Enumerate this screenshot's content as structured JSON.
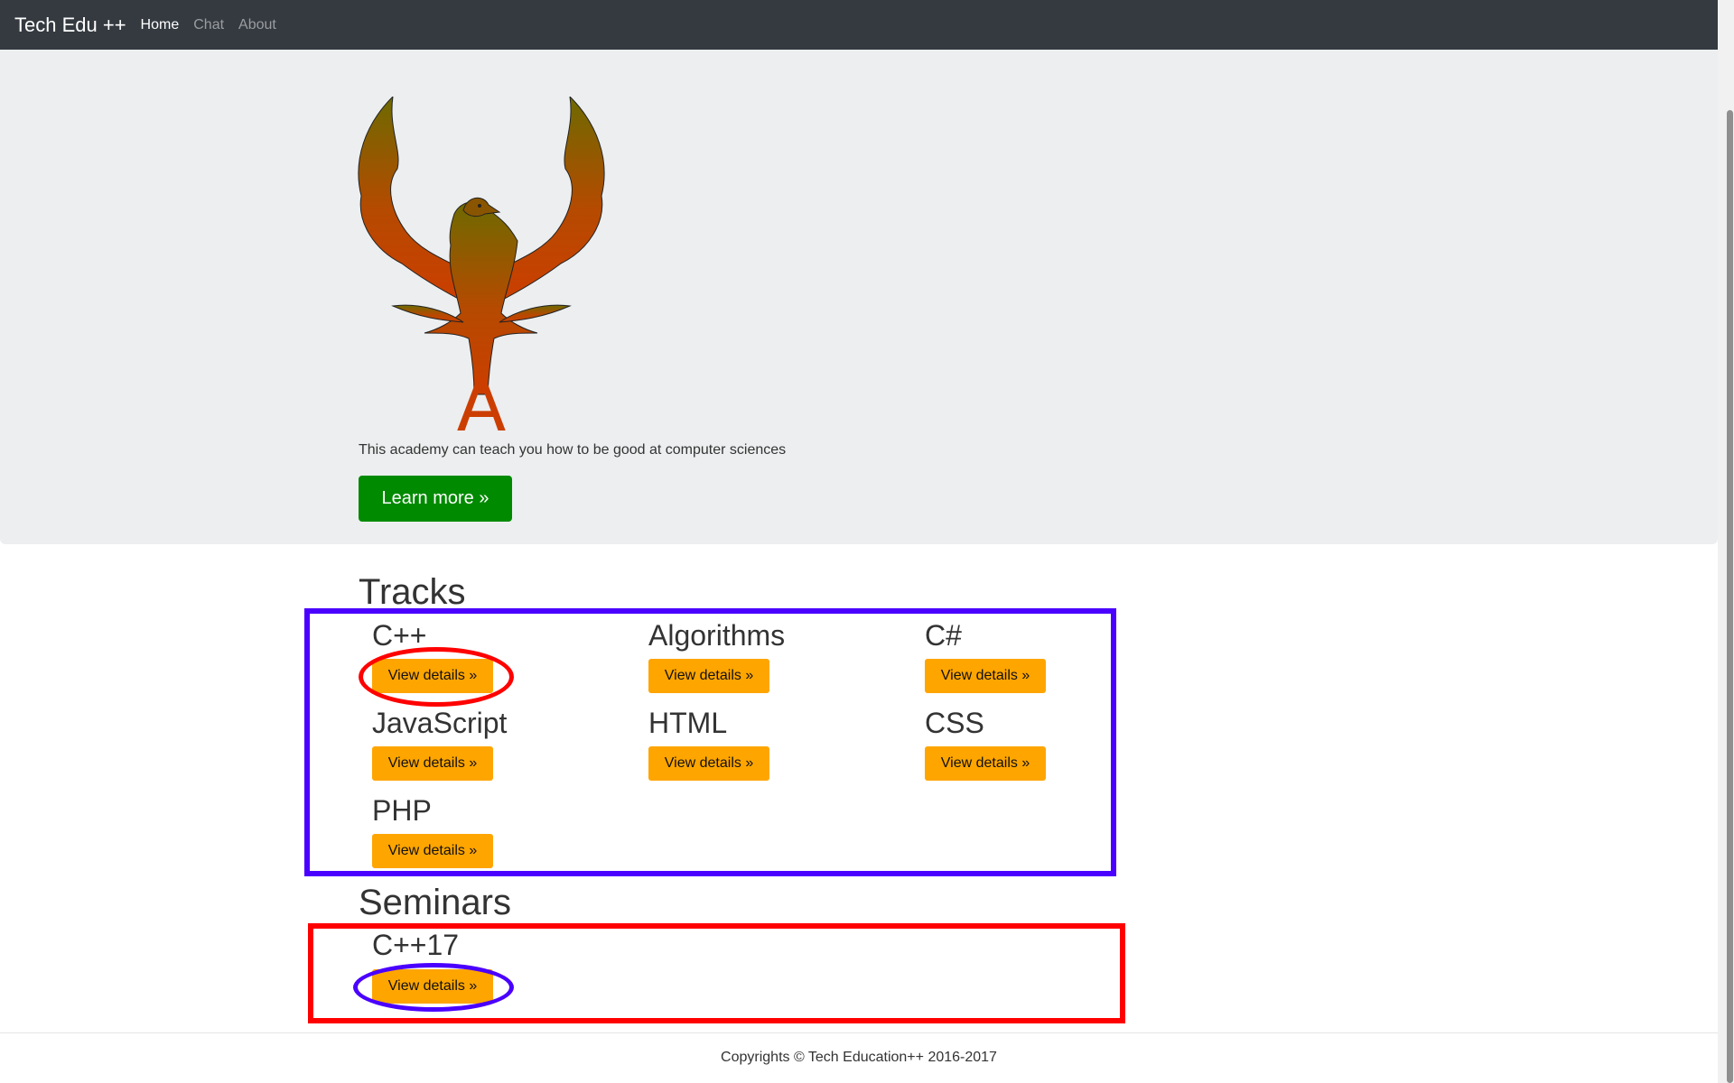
{
  "navbar": {
    "brand": "Tech Edu ++",
    "links": [
      {
        "label": "Home",
        "active": true
      },
      {
        "label": "Chat",
        "active": false
      },
      {
        "label": "About",
        "active": false
      }
    ]
  },
  "hero": {
    "logo_letter": "A",
    "tagline": "This academy can teach you how to be good at computer sciences",
    "learn_more": "Learn more »"
  },
  "tracks": {
    "title": "Tracks",
    "items": [
      {
        "name": "C++",
        "button": "View details »"
      },
      {
        "name": "Algorithms",
        "button": "View details »"
      },
      {
        "name": "C#",
        "button": "View details »"
      },
      {
        "name": "JavaScript",
        "button": "View details »"
      },
      {
        "name": "HTML",
        "button": "View details »"
      },
      {
        "name": "CSS",
        "button": "View details »"
      },
      {
        "name": "PHP",
        "button": "View details »"
      }
    ]
  },
  "seminars": {
    "title": "Seminars",
    "items": [
      {
        "name": "C++17",
        "button": "View details »"
      }
    ]
  },
  "footer": {
    "text": "Copyrights © Tech Education++ 2016-2017"
  },
  "colors": {
    "navbar_bg": "#343a40",
    "jumbotron_bg": "#eceeef",
    "learn_button": "#008a00",
    "details_button": "#ffa500",
    "annotation_blue": "#4a00ff",
    "annotation_red": "#ff0000"
  },
  "icons": {
    "logo": "phoenix-logo-icon"
  }
}
